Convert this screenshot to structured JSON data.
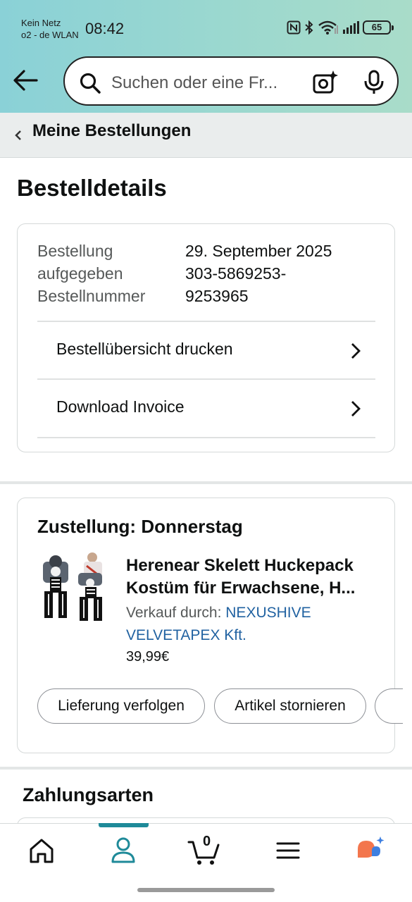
{
  "status_bar": {
    "carrier_line1": "Kein Netz",
    "carrier_line2": "o2 - de WLAN",
    "time": "08:42",
    "battery": "65"
  },
  "search": {
    "placeholder": "Suchen oder eine Fr..."
  },
  "breadcrumb": {
    "label": "Meine Bestellungen"
  },
  "page": {
    "title": "Bestelldetails"
  },
  "order_info": {
    "labels": [
      "Bestellung",
      "aufgegeben",
      "Bestellnummer"
    ],
    "date": "29. September 2025",
    "number_line1": "303-5869253-",
    "number_line2": "9253965",
    "actions": [
      {
        "label": "Bestellübersicht drucken"
      },
      {
        "label": "Download Invoice"
      }
    ]
  },
  "delivery": {
    "title": "Zustellung: Donnerstag",
    "product": {
      "title_line1": "Herenear Skelett Huckepack",
      "title_line2": "Kostüm für Erwachsene, H...",
      "sold_by_label": "Verkauf durch:",
      "seller_name": "NEXUSHIVE VELVETAPEX Kft.",
      "price": "39,99€"
    },
    "buttons": [
      {
        "label": "Lieferung verfolgen"
      },
      {
        "label": "Artikel stornieren"
      }
    ]
  },
  "payment": {
    "title": "Zahlungsarten"
  },
  "bottom_nav": {
    "cart_count": "0",
    "active_tab": "profile",
    "accent_color": "#1f8a99"
  },
  "colors": {
    "link": "#2162a1",
    "rufus_orange": "#f3764d",
    "rufus_blue": "#3d7fe0"
  }
}
